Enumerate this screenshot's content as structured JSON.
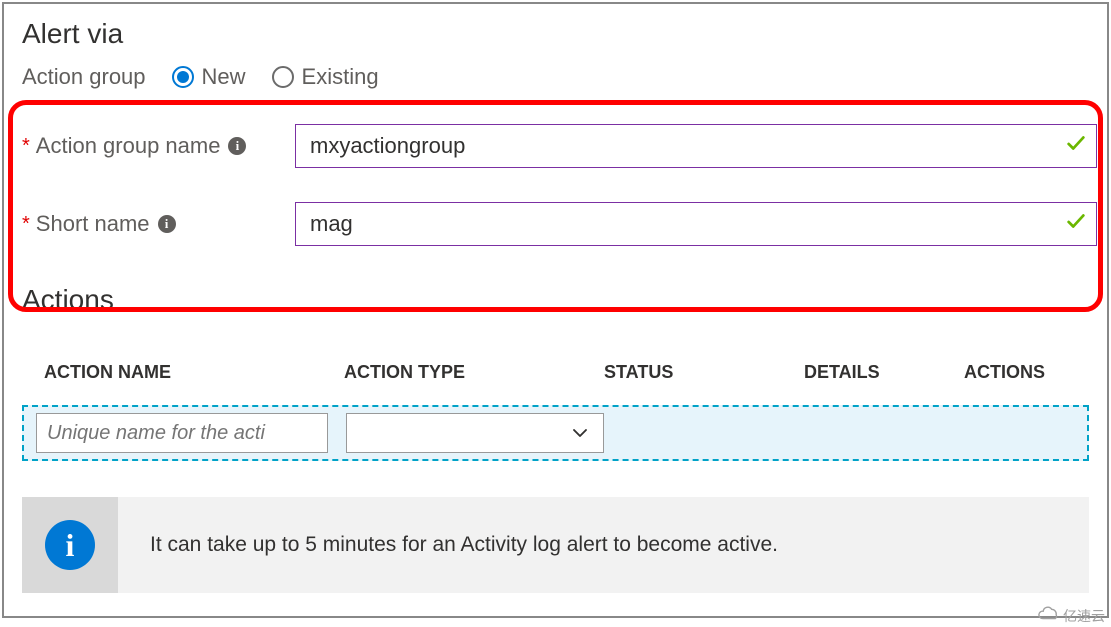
{
  "section": {
    "title": "Alert via",
    "subtitle_label": "Action group",
    "radio_new": "New",
    "radio_existing": "Existing"
  },
  "form": {
    "action_group_name": {
      "label": "Action group name",
      "value": "mxyactiongroup"
    },
    "short_name": {
      "label": "Short name",
      "value": "mag"
    }
  },
  "actions": {
    "title": "Actions",
    "columns": {
      "name": "ACTION NAME",
      "type": "ACTION TYPE",
      "status": "STATUS",
      "details": "DETAILS",
      "actions": "ACTIONS"
    },
    "row": {
      "name_placeholder": "Unique name for the acti",
      "type_value": ""
    }
  },
  "notice": {
    "text": "It can take up to 5 minutes for an Activity log alert to become active."
  },
  "watermark": "亿速云"
}
